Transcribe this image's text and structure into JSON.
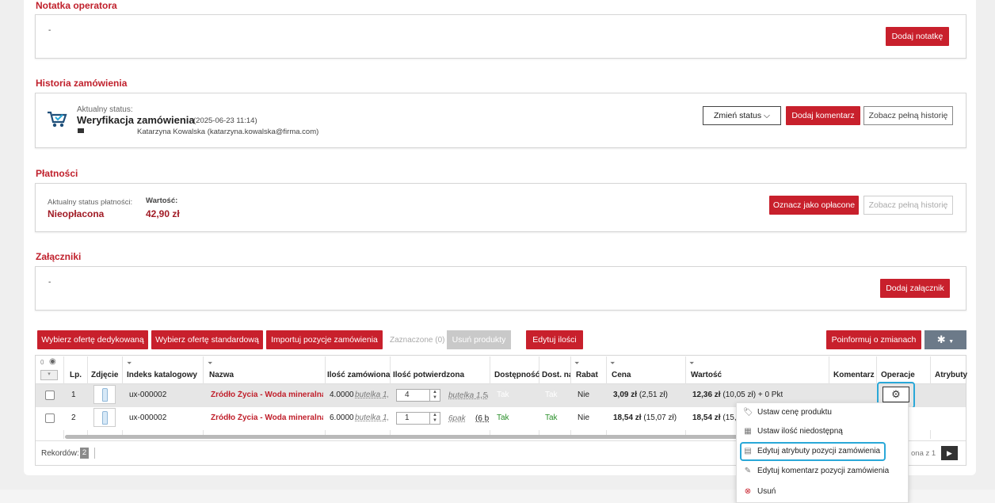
{
  "notes": {
    "title": "Notatka operatora",
    "content": "-",
    "add_button": "Dodaj notatkę"
  },
  "history": {
    "title": "Historia zamówienia",
    "status_label": "Aktualny status:",
    "status": "Weryfikacja zamówienia",
    "date": "(2025-06-23 11:14)",
    "user": "Katarzyna Kowalska (katarzyna.kowalska@firma.com)",
    "change_status": "Zmień status",
    "add_comment": "Dodaj komentarz",
    "full_history": "Zobacz pełną historię"
  },
  "payments": {
    "title": "Płatności",
    "status_label": "Aktualny status płatności:",
    "status": "Nieopłacona",
    "value_label": "Wartość:",
    "value": "42,90 zł",
    "mark_paid": "Oznacz jako opłacone",
    "full_history": "Zobacz pełną historię"
  },
  "attachments": {
    "title": "Załączniki",
    "content": "-",
    "add_button": "Dodaj załącznik"
  },
  "toolbar": {
    "dedicated": "Wybierz ofertę dedykowaną",
    "standard": "Wybierz ofertę standardową",
    "import": "Importuj pozycje zamówienia",
    "selected": "Zaznaczone (0)",
    "remove": "Usuń produkty",
    "edit_qty": "Edytuj ilości",
    "notify": "Poinformuj o zmianach"
  },
  "table": {
    "headers": {
      "lp": "Lp.",
      "photo": "Zdjęcie",
      "index": "Indeks katalogowy",
      "name": "Nazwa",
      "qty_ordered": "Ilość zamówiona",
      "qty_confirmed": "Ilość potwierdzona",
      "availability": "Dostępność",
      "delivery": "Dost. na",
      "discount": "Rabat",
      "price": "Cena",
      "value": "Wartość",
      "comment": "Komentarz",
      "operations": "Operacje",
      "attributes": "Atrybuty"
    },
    "col_count": "0",
    "rows": [
      {
        "lp": "1",
        "index": "ux-000002",
        "name": "Źródło Życia - Woda mineralna ja",
        "qty_ordered": "4.0000",
        "qty_unit": "butelka 1,",
        "qty_confirmed": "4",
        "confirmed_unit": "butelka 1,5l",
        "availability": "Tak",
        "delivery": "Tak",
        "discount": "Nie",
        "price": "3,09 zł",
        "price_net": "(2,51 zł)",
        "value": "12,36 zł",
        "value_net": "(10,05 zł) + 0 Pkt"
      },
      {
        "lp": "2",
        "index": "ux-000002",
        "name": "Źródło Życia - Woda mineralna ja",
        "qty_ordered": "6.0000",
        "qty_unit": "butelka 1,",
        "qty_confirmed": "1",
        "confirmed_unit": "6pak",
        "confirmed_extra": "(6 b",
        "availability": "Tak",
        "delivery": "Tak",
        "discount": "Nie",
        "price": "18,54 zł",
        "price_net": "(15,07 zł)",
        "value": "18,54 zł",
        "value_net": "(15,0"
      }
    ],
    "records_label": "Rekordów:",
    "records_count": "2",
    "page_info": "ona z 1"
  },
  "context_menu": {
    "items": [
      "Ustaw cenę produktu",
      "Ustaw ilość niedostępną",
      "Edytuj atrybuty pozycji zamówienia",
      "Edytuj komentarz pozycji zamówienia",
      "Usuń"
    ]
  },
  "colors": {
    "accent": "#c8202c",
    "highlight": "#2aa8d8"
  }
}
